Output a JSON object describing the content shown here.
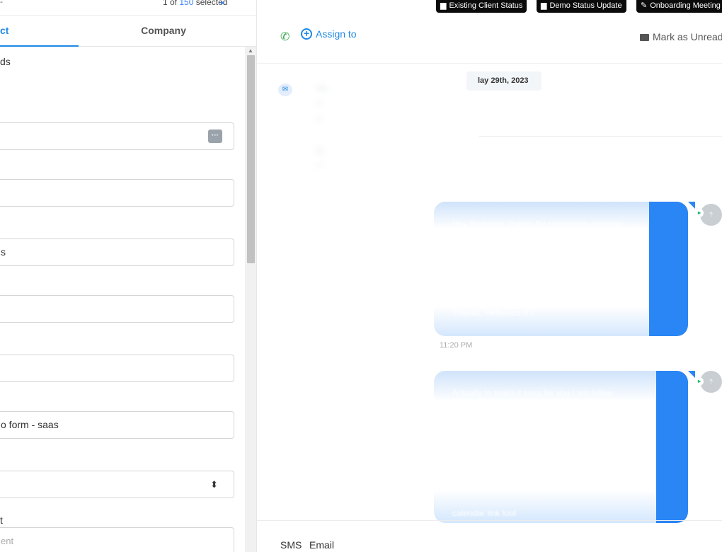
{
  "pagination": {
    "dash": "-",
    "label": "1 of",
    "count": "150",
    "suffix": "selected",
    "next_arrow": "▸"
  },
  "tabs": {
    "contact": "ct",
    "company": "Company"
  },
  "form": {
    "fields": [
      {
        "label": "ds",
        "value": "",
        "icon": "more-options-icon"
      },
      {
        "label": "",
        "value": ""
      },
      {
        "label": "",
        "value": "s"
      },
      {
        "label": "",
        "value": ""
      },
      {
        "label": "",
        "value": ""
      },
      {
        "label": "",
        "value": "o form - saas"
      },
      {
        "label": "",
        "value": "",
        "icon": "updown-icon"
      },
      {
        "label": "t",
        "placeholder": "ent"
      }
    ]
  },
  "workflows": [
    {
      "label": "Existing Client Status",
      "icon": "doc-icon"
    },
    {
      "label": "Demo Status Update",
      "icon": "id-card-icon"
    },
    {
      "label": "Onboarding Meeting",
      "icon": "wrench-icon"
    }
  ],
  "actions": {
    "assign": "Assign to",
    "mark_unread": "Mark as Unread"
  },
  "conversation": {
    "date_chip": "lay 29th, 2023",
    "email_preview": [
      "He",
      "T",
      "Y",
      "[h",
      "**"
    ],
    "messages": [
      {
        "lines": [
          "Hey Rodovan, thanks for requesting calendar",
          "Thanks, Hellorezo A.I"
        ],
        "time": "11:20 PM",
        "avatar": "?"
      },
      {
        "lines": [
          "Actually to make it easy for you I am follow",
          "calendar link tool"
        ],
        "avatar": "?"
      }
    ]
  },
  "composer": {
    "tab_sms": "SMS",
    "tab_email": "Email"
  },
  "colors": {
    "accent": "#1e88e5",
    "bubble": "#2a85f5",
    "phone_green": "#3aa650"
  }
}
